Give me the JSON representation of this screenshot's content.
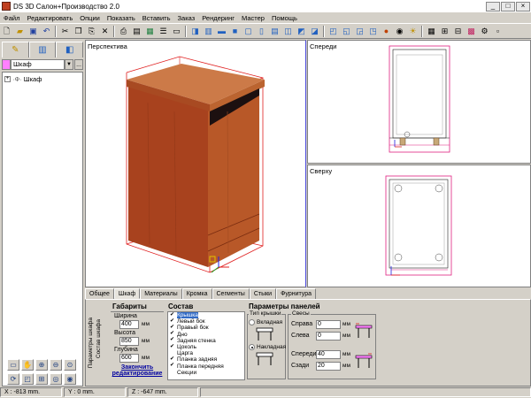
{
  "window": {
    "title": "DS 3D Салон+Производство 2.0"
  },
  "menu": [
    "Файл",
    "Редактировать",
    "Опции",
    "Показать",
    "Вставить",
    "Заказ",
    "Рендеринг",
    "Мастер",
    "Помощь"
  ],
  "toolbar_icons": [
    "new-icon",
    "open-icon",
    "save-icon",
    "undo-icon",
    "cut-icon",
    "copy-icon",
    "paste-icon",
    "delete-icon",
    "print-icon",
    "print-preview-icon",
    "view-icon",
    "grid-icon",
    "render-icon",
    "settings-icon"
  ],
  "left": {
    "combo_value": "Шкаф",
    "tree_item": "Шкаф"
  },
  "views": {
    "perspective": "Перспектива",
    "front": "Спереди",
    "top": "Сверху"
  },
  "tabs": [
    "Общее",
    "Шкаф",
    "Материалы",
    "Кромка",
    "Сегменты",
    "Стыки",
    "Фурнитура"
  ],
  "active_tab": "Шкаф",
  "panel": {
    "side_label_1": "Параметры шкафа",
    "side_label_2": "Состав шкафа",
    "dims_title": "Габариты",
    "width_label": "Ширина",
    "width_value": "400",
    "height_label": "Высота",
    "height_value": "850",
    "depth_label": "Глубина",
    "depth_value": "600",
    "unit": "мм",
    "finish_label": "Закончить редактирование",
    "composition_title": "Состав",
    "composition": [
      {
        "label": "Крышка",
        "checked": true,
        "selected": true
      },
      {
        "label": "Левый бок",
        "checked": true
      },
      {
        "label": "Правый бок",
        "checked": true
      },
      {
        "label": "Дно",
        "checked": true
      },
      {
        "label": "Задняя стенка",
        "checked": true
      },
      {
        "label": "Цоколь",
        "checked": true
      },
      {
        "label": "Царга",
        "checked": false
      },
      {
        "label": "Планка задняя",
        "checked": true
      },
      {
        "label": "Планка передняя",
        "checked": true
      },
      {
        "label": "Секции",
        "checked": false
      }
    ],
    "panels_title": "Параметры панелей",
    "lid_type_label": "Тип крышки",
    "lid_option_inset": "Вкладная",
    "lid_option_overlay": "Накладная",
    "overhang_label": "Свесы",
    "right_label": "Справа",
    "right_value": "0",
    "left_label": "Слева",
    "left_value": "0",
    "front_label": "Спереди",
    "front_value": "40",
    "back_label": "Сзади",
    "back_value": "20"
  },
  "status": {
    "x": "X : -813 mm.",
    "y": "Y : 0 mm.",
    "z": "Z : -647 mm."
  }
}
